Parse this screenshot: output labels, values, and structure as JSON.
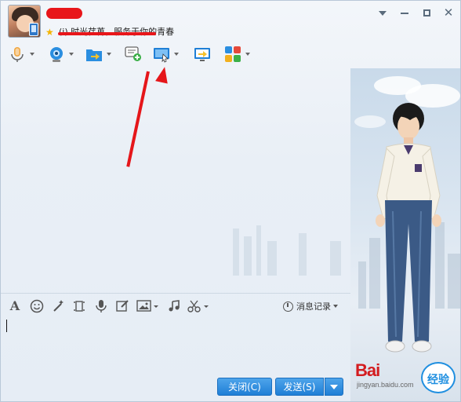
{
  "window": {
    "status_text": "(i) 时光荏苒，服务于你的青春"
  },
  "history": {
    "label": "消息记录"
  },
  "buttons": {
    "close_label": "关闭(C)",
    "send_label": "发送(S)"
  },
  "watermark": {
    "brand": "Bai",
    "badge": "经验",
    "sub": "jingyan.baidu.com"
  },
  "colors": {
    "accent_button": "#1f7fd6",
    "annotation_red": "#e5161a"
  },
  "icons": {
    "toolbar": [
      "microphone-icon",
      "webcam-icon",
      "send-file-icon",
      "add-chat-icon",
      "remote-desktop-icon",
      "screen-share-icon",
      "apps-grid-icon"
    ],
    "input_toolbar": [
      "font-icon",
      "emoji-icon",
      "magic-wand-icon",
      "screenshot-icon",
      "voice-message-icon",
      "edit-icon",
      "image-icon",
      "music-icon",
      "scissors-icon"
    ]
  }
}
